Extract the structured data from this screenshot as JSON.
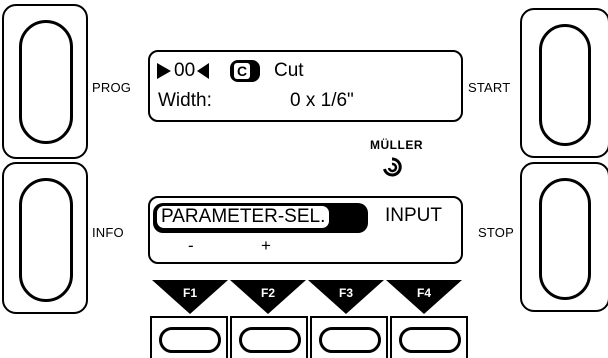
{
  "left_keys": [
    {
      "label": "PROG"
    },
    {
      "label": "INFO"
    }
  ],
  "right_keys": [
    {
      "label": "START"
    },
    {
      "label": "STOP"
    }
  ],
  "top_display": {
    "program_number": "00",
    "mode_badge": "C",
    "mode_label": "Cut",
    "width_label": "Width:",
    "width_value": "0 x 1/6\""
  },
  "brand": {
    "name": "MÜLLER",
    "logo_icon": "swirl-icon"
  },
  "bottom_display": {
    "selected_item": "PARAMETER-SEL.",
    "other_item": "INPUT",
    "minus": "-",
    "plus": "+"
  },
  "function_keys": [
    {
      "label": "F1"
    },
    {
      "label": "F2"
    },
    {
      "label": "F3"
    },
    {
      "label": "F4"
    }
  ]
}
